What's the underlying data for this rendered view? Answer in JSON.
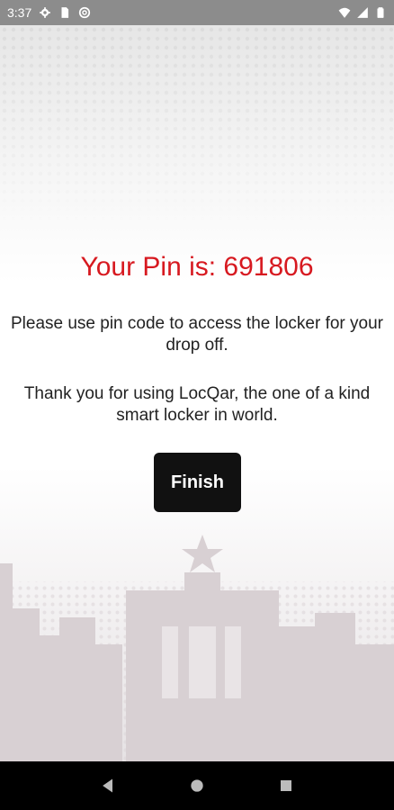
{
  "status_bar": {
    "time": "3:37",
    "left_icons": [
      "gear-icon",
      "sim-card-icon",
      "at-sign-icon"
    ],
    "right_icons": [
      "wifi-icon",
      "signal-icon",
      "battery-icon"
    ]
  },
  "main": {
    "pin_title": "Your Pin is: 691806",
    "message_line1": "Please use pin code to access the locker for your drop off.",
    "message_line2": "Thank you for using LocQar, the one of a kind smart locker in world.",
    "finish_label": "Finish"
  },
  "nav_bar": {
    "buttons": [
      "back-triangle-icon",
      "home-circle-icon",
      "recents-square-icon"
    ]
  },
  "colors": {
    "accent_red": "#d71920",
    "button_dark": "#111111",
    "status_bar": "#8c8c8c"
  }
}
